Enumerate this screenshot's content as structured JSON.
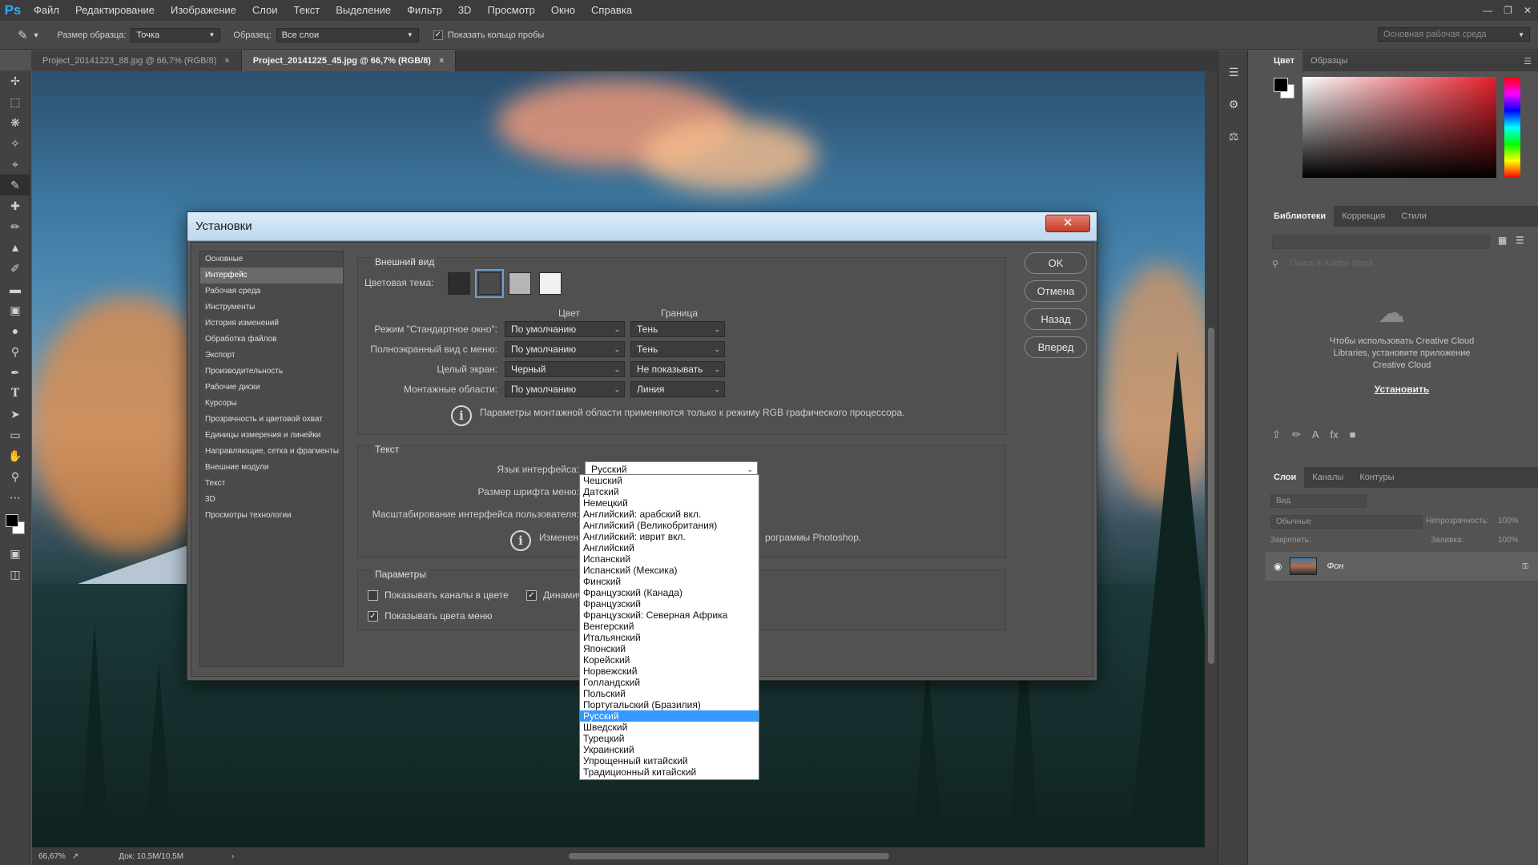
{
  "app": {
    "logo": "Ps"
  },
  "menu": [
    "Файл",
    "Редактирование",
    "Изображение",
    "Слои",
    "Текст",
    "Выделение",
    "Фильтр",
    "3D",
    "Просмотр",
    "Окно",
    "Справка"
  ],
  "options": {
    "sample_size_label": "Размер образца:",
    "sample_size_value": "Точка",
    "sample_label": "Образец:",
    "sample_value": "Все слои",
    "ring_label": "Показать кольцо пробы",
    "workspace": "Основная рабочая среда"
  },
  "doc_tabs": [
    {
      "label": "Project_20141223_88.jpg @ 66,7% (RGB/8)",
      "close": "×"
    },
    {
      "label": "Project_20141225_45.jpg @ 66,7% (RGB/8)",
      "close": "×"
    }
  ],
  "status": {
    "zoom": "66,67%",
    "doc": "Док: 10,5M/10,5M"
  },
  "panels": {
    "color_tabs": [
      "Цвет",
      "Образцы"
    ],
    "lib_tabs": [
      "Библиотеки",
      "Коррекция",
      "Стили"
    ],
    "lib_search_placeholder": "Поиск в Adobe Stock",
    "lib_hint": "Чтобы использовать Creative Cloud Libraries, установите приложение Creative Cloud",
    "lib_install": "Установить",
    "layer_tabs": [
      "Слои",
      "Каналы",
      "Контуры"
    ],
    "layer_filter": "Вид",
    "blend_mode": "Обычные",
    "opacity_label": "Непрозрачность:",
    "opacity_value": "100%",
    "lock_label": "Закрепить:",
    "fill_label": "Заливка:",
    "fill_value": "100%",
    "layer_name": "Фон"
  },
  "dialog": {
    "title": "Установки",
    "close": "✕",
    "nav": [
      "Основные",
      "Интерфейс",
      "Рабочая среда",
      "Инструменты",
      "История изменений",
      "Обработка файлов",
      "Экспорт",
      "Производительность",
      "Рабочие диски",
      "Курсоры",
      "Прозрачность и цветовой охват",
      "Единицы измерения и линейки",
      "Направляющие, сетка и фрагменты",
      "Внешние модули",
      "Текст",
      "3D",
      "Просмотры технологии"
    ],
    "nav_selected": 1,
    "buttons": [
      "OK",
      "Отмена",
      "Назад",
      "Вперед"
    ],
    "appearance": {
      "legend": "Внешний вид",
      "theme_label": "Цветовая тема:",
      "themes": [
        "#2d2d2d",
        "#4a4a4a",
        "#b5b5b5",
        "#f1f1f1"
      ],
      "theme_selected": 1,
      "col_color": "Цвет",
      "col_border": "Граница",
      "rows": [
        {
          "label": "Режим \"Стандартное окно\":",
          "color": "По умолчанию",
          "border": "Тень"
        },
        {
          "label": "Полноэкранный вид с меню:",
          "color": "По умолчанию",
          "border": "Тень"
        },
        {
          "label": "Целый экран:",
          "color": "Черный",
          "border": "Не показывать"
        },
        {
          "label": "Монтажные области:",
          "color": "По умолчанию",
          "border": "Линия"
        }
      ],
      "info": "Параметры монтажной области применяются только к режиму RGB графического процессора."
    },
    "text": {
      "legend": "Текст",
      "lang_label": "Язык интерфейса:",
      "lang_value": "Русский",
      "font_size_label": "Размер шрифта меню:",
      "scale_label": "Масштабирование интерфейса пользователя:",
      "info_start": "Изменен",
      "info_end": "рограммы Photoshop."
    },
    "params": {
      "legend": "Параметры",
      "channels_label": "Показывать каналы в цвете",
      "channels_checked": false,
      "dynamic_label": "Динамич",
      "dynamic_checked": true,
      "menu_colors_label": "Показывать цвета меню",
      "menu_colors_checked": true
    }
  },
  "languages": [
    "Чешский",
    "Датский",
    "Немецкий",
    "Английский: арабский вкл.",
    "Английский (Великобритания)",
    "Английский: иврит вкл.",
    "Английский",
    "Испанский",
    "Испанский (Мексика)",
    "Финский",
    "Французский (Канада)",
    "Французский",
    "Французский: Северная Африка",
    "Венгерский",
    "Итальянский",
    "Японский",
    "Корейский",
    "Норвежский",
    "Голландский",
    "Польский",
    "Португальский (Бразилия)",
    "Русский",
    "Шведский",
    "Турецкий",
    "Украинский",
    "Упрощенный китайский",
    "Традиционный китайский"
  ],
  "language_selected": "Русский"
}
